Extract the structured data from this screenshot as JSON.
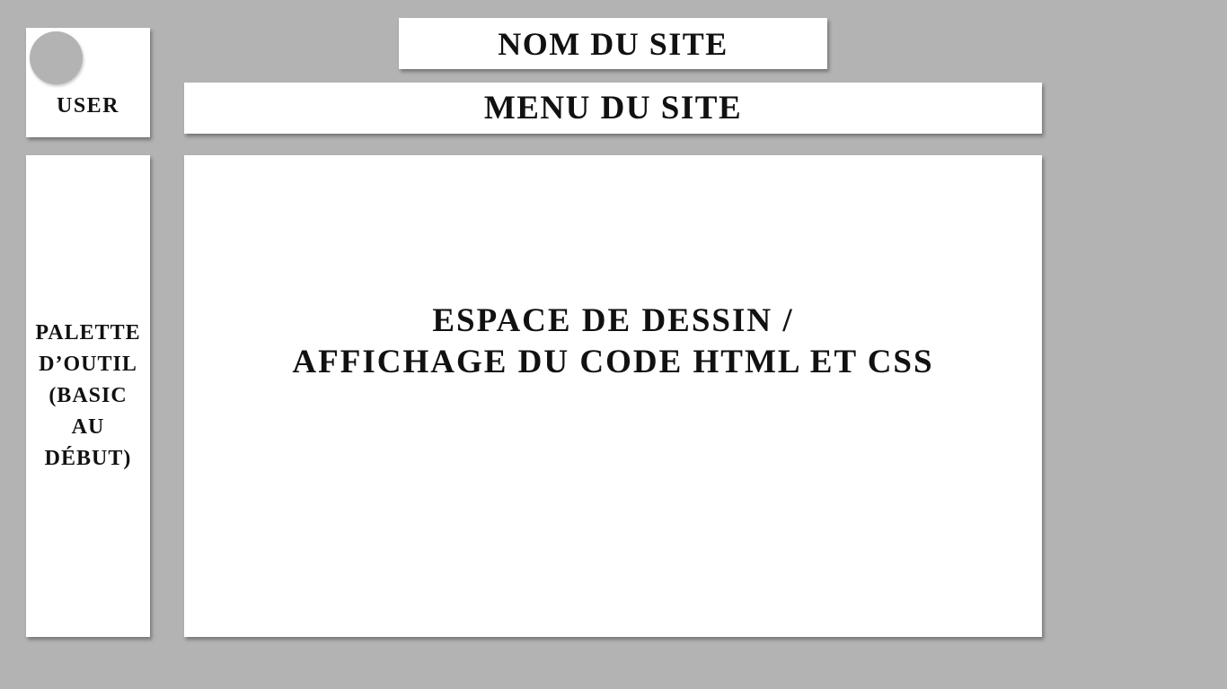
{
  "header": {
    "site_name": "NOM DU SITE",
    "site_menu": "MENU DU SITE"
  },
  "user": {
    "label": "USER",
    "avatar_icon": "user-avatar-icon"
  },
  "sidebar": {
    "palette_label": "PALETTE\nD’OUTIL\n(BASIC\nAU\nDÉBUT)"
  },
  "main": {
    "canvas_label": "ESPACE DE DESSIN /\nAFFICHAGE DU CODE HTML ET CSS"
  },
  "colors": {
    "background": "#b3b3b3",
    "panel": "#ffffff",
    "text": "#111111"
  }
}
